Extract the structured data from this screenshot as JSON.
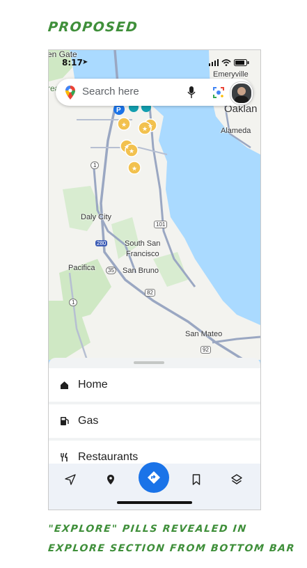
{
  "header": {
    "title": "PROPOSED"
  },
  "caption": {
    "line1": "\"EXPLORE\" PILLS REVEALED IN",
    "line2": "EXPLORE SECTION FROM BOTTOM BAR"
  },
  "status": {
    "time": "8:17"
  },
  "search": {
    "placeholder": "Search here"
  },
  "map_labels": {
    "golden_gate": "en Gate",
    "recreation": "reatio",
    "emeryville": "Emeryville",
    "oakland": "Oaklan",
    "alameda": "Alameda",
    "daly_city": "Daly City",
    "south_sf_1": "South San",
    "south_sf_2": "Francisco",
    "pacifica": "Pacifica",
    "san_bruno": "San Bruno",
    "san_mateo": "San Mateo",
    "hwy_1a": "1",
    "hwy_1b": "1",
    "hwy_101": "101",
    "hwy_280": "280",
    "hwy_35": "35",
    "hwy_82": "82",
    "hwy_92": "92"
  },
  "explore_pills": [
    {
      "label": "Home",
      "icon": "home-icon"
    },
    {
      "label": "Gas",
      "icon": "gas-station-icon"
    },
    {
      "label": "Restaurants",
      "icon": "restaurant-icon"
    }
  ],
  "bottom_nav": [
    "navigation-arrow-icon",
    "location-pin-icon",
    "directions-icon",
    "bookmark-icon",
    "layers-icon"
  ],
  "colors": {
    "accent": "#1a73e8",
    "annotation": "#3f8f3a",
    "water": "#aadaff",
    "land": "#f3f3ef",
    "park": "#cfe8c4"
  }
}
